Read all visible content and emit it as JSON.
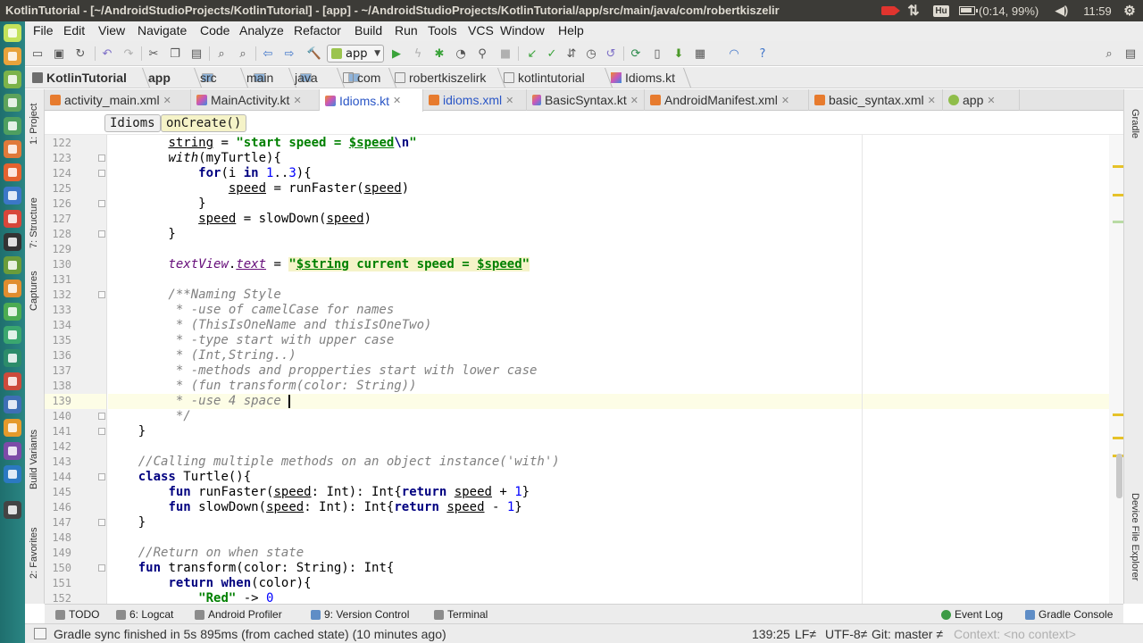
{
  "os": {
    "window_title": "KotlinTutorial - [~/AndroidStudioProjects/KotlinTutorial] - [app] - ~/AndroidStudioProjects/KotlinTutorial/app/src/main/java/com/robertkiszelir",
    "keyboard_layout": "Hu",
    "battery": "(0:14, 99%)",
    "clock": "11:59"
  },
  "menu": [
    "File",
    "Edit",
    "View",
    "Navigate",
    "Code",
    "Analyze",
    "Refactor",
    "Build",
    "Run",
    "Tools",
    "VCS",
    "Window",
    "Help"
  ],
  "toolbar": {
    "run_config": "app"
  },
  "breadcrumb": [
    "KotlinTutorial",
    "app",
    "src",
    "main",
    "java",
    "com",
    "robertkiszelirk",
    "kotlintutorial",
    "Idioms.kt"
  ],
  "tabs": [
    {
      "label": "activity_main.xml",
      "type": "xml"
    },
    {
      "label": "MainActivity.kt",
      "type": "kt"
    },
    {
      "label": "Idioms.kt",
      "type": "kt",
      "active": true
    },
    {
      "label": "idioms.xml",
      "type": "xml"
    },
    {
      "label": "BasicSyntax.kt",
      "type": "kt"
    },
    {
      "label": "AndroidManifest.xml",
      "type": "xml"
    },
    {
      "label": "basic_syntax.xml",
      "type": "xml"
    },
    {
      "label": "app",
      "type": "app"
    }
  ],
  "editor_crumbs": [
    "Idioms",
    "onCreate()"
  ],
  "side_panels": {
    "left": [
      "1: Project",
      "7: Structure",
      "Captures",
      "Build Variants",
      "2: Favorites"
    ],
    "right": [
      "Gradle",
      "Device File Explorer"
    ]
  },
  "code": {
    "first_line": 122,
    "current_line": 139,
    "lines": [
      "        string = \"start speed = $speed\\n\"",
      "        with(myTurtle){",
      "            for(i in 1..3){",
      "                speed = runFaster(speed)",
      "            }",
      "            speed = slowDown(speed)",
      "        }",
      "",
      "        textView.text = \"$string current speed = $speed\"",
      "",
      "        /**Naming Style",
      "         * -use of camelCase for names",
      "         * (ThisIsOneName and thisIsOneTwo)",
      "         * -type start with upper case",
      "         * (Int,String..)",
      "         * -methods and propperties start with lower case",
      "         * (fun transform(color: String))",
      "         * -use 4 space ",
      "         */",
      "    }",
      "",
      "    //Calling multiple methods on an object instance('with')",
      "    class Turtle(){",
      "        fun runFaster(speed: Int): Int{return speed + 1}",
      "        fun slowDown(speed: Int): Int{return speed - 1}",
      "    }",
      "",
      "    //Return on when state",
      "    fun transform(color: String): Int{",
      "        return when(color){",
      "            \"Red\" -> 0"
    ]
  },
  "tool_windows": {
    "left": [
      "TODO",
      "6: Logcat",
      "Android Profiler",
      "9: Version Control",
      "Terminal"
    ],
    "right": [
      "Event Log",
      "Gradle Console"
    ]
  },
  "status": {
    "message": "Gradle sync finished in 5s 895ms (from cached state) (10 minutes ago)",
    "position": "139:25",
    "line_sep": "LF≠",
    "encoding": "UTF-8≠",
    "git": "Git: master ≠",
    "context": "Context: <no context>"
  }
}
